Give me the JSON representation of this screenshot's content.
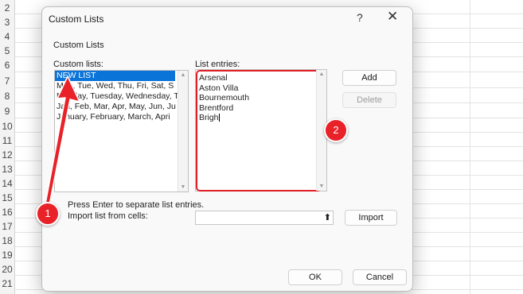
{
  "sheet": {
    "rows": [
      "2",
      "3",
      "4",
      "5",
      "6",
      "7",
      "8",
      "9",
      "10",
      "11",
      "12",
      "13",
      "14",
      "15",
      "16",
      "17",
      "18",
      "19",
      "20",
      "21"
    ]
  },
  "dialog": {
    "title": "Custom Lists",
    "help_symbol": "?",
    "close_symbol": "✕",
    "group_label": "Custom Lists",
    "custom_lists_label": "Custom lists:",
    "list_entries_label": "List entries:",
    "custom_lists": [
      "NEW LIST",
      "Mon, Tue, Wed, Thu, Fri, Sat, S",
      "Monday, Tuesday, Wednesday, T",
      "Jan, Feb, Mar, Apr, May, Jun, Ju",
      "January, February, March, Apri"
    ],
    "selected_index": 0,
    "entries": [
      "Arsenal",
      "Aston Villa",
      "Bournemouth",
      "Brentford",
      "Brigh"
    ],
    "add_label": "Add",
    "delete_label": "Delete",
    "hint": "Press Enter to separate list entries.",
    "import_label": "Import list from cells:",
    "import_value": "",
    "import_button": "Import",
    "ok_label": "OK",
    "cancel_label": "Cancel"
  },
  "annotations": {
    "callout_1": "1",
    "callout_2": "2",
    "accent_color": "#e82228"
  },
  "icons": {
    "help": "help-icon",
    "close": "close-icon",
    "upload": "upload-icon",
    "scroll_up": "scroll-up-icon",
    "scroll_down": "scroll-down-icon"
  }
}
